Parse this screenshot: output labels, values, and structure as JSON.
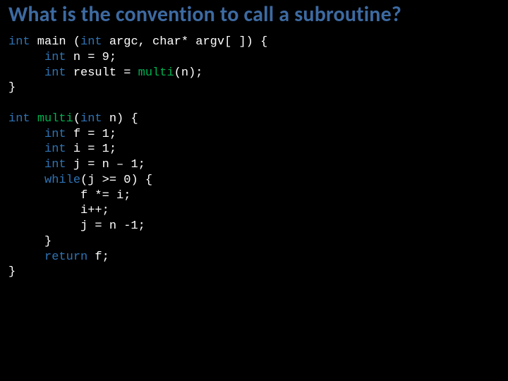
{
  "title": "What is the convention to call a subroutine?",
  "keywords": {
    "int": "int",
    "while": "while",
    "return": "return"
  },
  "fn": {
    "multi": "multi"
  },
  "code": {
    "l1a": " main (",
    "l1b": " argc, char* argv[ ]) {",
    "l2a": "     ",
    "l2b": " n = 9;",
    "l3a": "     ",
    "l3b": " result = ",
    "l3c": "(n);",
    "l4": "}",
    "l6a": " ",
    "l6b": "(",
    "l6c": " n) {",
    "l7a": "     ",
    "l7b": " f = 1;",
    "l8a": "     ",
    "l8b": " i = 1;",
    "l9a": "     ",
    "l9b": " j = n – 1;",
    "l10a": "     ",
    "l10b": "(j >= 0) {",
    "l11": "          f *= i;",
    "l12": "          i++;",
    "l13": "          j = n -1;",
    "l14": "     }",
    "l15a": "     ",
    "l15b": " f;",
    "l16": "}"
  }
}
